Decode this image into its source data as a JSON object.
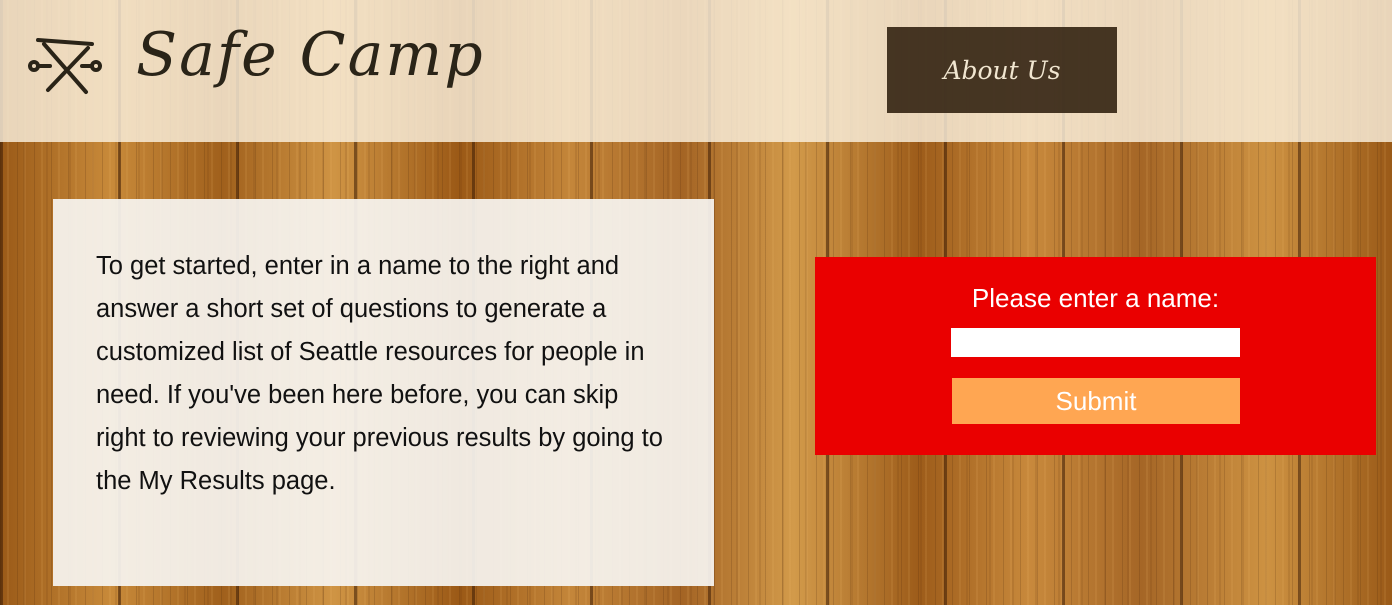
{
  "header": {
    "logo_icon": "campfire-sticks-icon",
    "app_title": "Safe Camp",
    "about_label": "About Us"
  },
  "intro": {
    "text": "To get started, enter in a name to the right and answer a short set of questions to generate a customized list of Seattle resources for people in need. If you've been here before, you can skip right to reviewing your previous results by going to the My Results page."
  },
  "form": {
    "label": "Please enter a name:",
    "name_value": "",
    "name_placeholder": "",
    "submit_label": "Submit"
  },
  "colors": {
    "form_background": "#ea0000",
    "submit_background": "#ffa652",
    "about_background": "#2d1e0c",
    "header_overlay": "#faf0de"
  }
}
